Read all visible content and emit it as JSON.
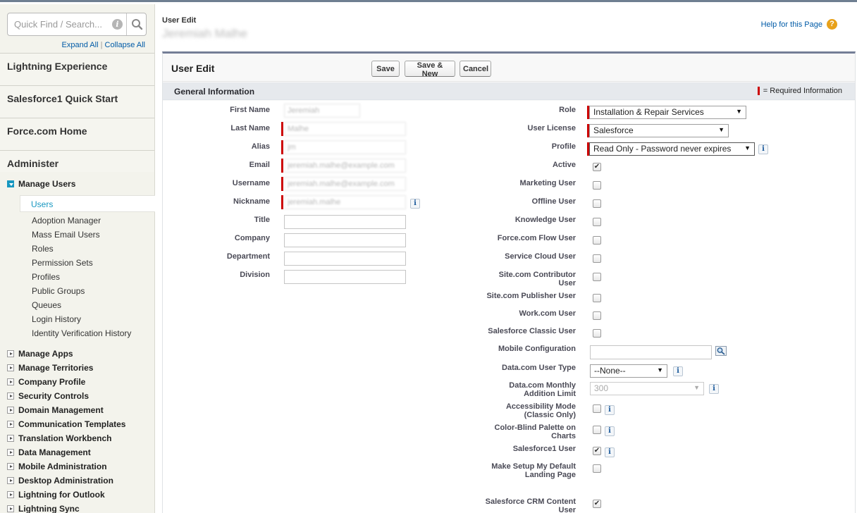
{
  "sidebar": {
    "search_placeholder": "Quick Find / Search...",
    "expand_all": "Expand All",
    "separator": "|",
    "collapse_all": "Collapse All",
    "sections": [
      "Lightning Experience",
      "Salesforce1 Quick Start",
      "Force.com Home",
      "Administer"
    ],
    "manage_users": "Manage Users",
    "manage_users_items": [
      "Users",
      "Adoption Manager",
      "Mass Email Users",
      "Roles",
      "Permission Sets",
      "Profiles",
      "Public Groups",
      "Queues",
      "Login History",
      "Identity Verification History"
    ],
    "collapsed_groups": [
      "Manage Apps",
      "Manage Territories",
      "Company Profile",
      "Security Controls",
      "Domain Management",
      "Communication Templates",
      "Translation Workbench",
      "Data Management",
      "Mobile Administration",
      "Desktop Administration",
      "Lightning for Outlook",
      "Lightning Sync"
    ]
  },
  "page": {
    "breadcrumb_label": "User Edit",
    "breadcrumb_name": "Jeremiah Malhe",
    "help_link": "Help for this Page"
  },
  "panel": {
    "title": "User Edit",
    "buttons": {
      "save": "Save",
      "save_new": "Save & New",
      "cancel": "Cancel"
    },
    "section_title": "General Information",
    "required_legend": "= Required Information"
  },
  "left_fields": [
    {
      "label": "First Name",
      "value": "Jeremiah"
    },
    {
      "label": "Last Name",
      "value": "Malhe"
    },
    {
      "label": "Alias",
      "value": "jm"
    },
    {
      "label": "Email",
      "value": "jeremiah.malhe@example.com"
    },
    {
      "label": "Username",
      "value": "jeremiah.malhe@example.com"
    },
    {
      "label": "Nickname",
      "value": "jeremiah.malhe"
    },
    {
      "label": "Title",
      "value": ""
    },
    {
      "label": "Company",
      "value": ""
    },
    {
      "label": "Department",
      "value": ""
    },
    {
      "label": "Division",
      "value": ""
    }
  ],
  "right_fields": {
    "role": {
      "label": "Role",
      "value": "Installation & Repair Services"
    },
    "user_license": {
      "label": "User License",
      "value": "Salesforce"
    },
    "profile": {
      "label": "Profile",
      "value": "Read Only - Password never expires"
    },
    "active": {
      "label": "Active",
      "checked": true
    },
    "marketing_user": {
      "label": "Marketing User",
      "checked": false
    },
    "offline_user": {
      "label": "Offline User",
      "checked": false
    },
    "knowledge_user": {
      "label": "Knowledge User",
      "checked": false
    },
    "flow_user": {
      "label": "Force.com Flow User",
      "checked": false
    },
    "service_cloud_user": {
      "label": "Service Cloud User",
      "checked": false
    },
    "site_contributor": {
      "label1": "Site.com Contributor",
      "label2": "User",
      "checked": false
    },
    "site_publisher": {
      "label": "Site.com Publisher User",
      "checked": false
    },
    "work_user": {
      "label": "Work.com User",
      "checked": false
    },
    "classic_user": {
      "label": "Salesforce Classic User",
      "checked": false
    },
    "mobile_config": {
      "label": "Mobile Configuration",
      "value": ""
    },
    "datacom_type": {
      "label": "Data.com User Type",
      "value": "--None--"
    },
    "datacom_limit": {
      "label1": "Data.com Monthly",
      "label2": "Addition Limit",
      "value": "300"
    },
    "accessibility": {
      "label1": "Accessibility Mode",
      "label2": "(Classic Only)",
      "checked": false
    },
    "color_blind": {
      "label1": "Color-Blind Palette on",
      "label2": "Charts",
      "checked": false
    },
    "sf1_user": {
      "label": "Salesforce1 User",
      "checked": true
    },
    "setup_landing": {
      "label1": "Make Setup My Default",
      "label2": "Landing Page",
      "checked": false
    },
    "crm_content": {
      "label1": "Salesforce CRM Content",
      "label2": "User",
      "checked": true
    }
  },
  "colors": {
    "required": "#cc0000",
    "link": "#015ba7",
    "header_border": "#747e96",
    "tree_open": "#1797c0"
  },
  "icons": {
    "search": "search-icon",
    "info": "info-icon",
    "help": "help-icon",
    "lookup": "lookup-icon",
    "check": "✔",
    "info_glyph": "i",
    "help_glyph": "?"
  }
}
